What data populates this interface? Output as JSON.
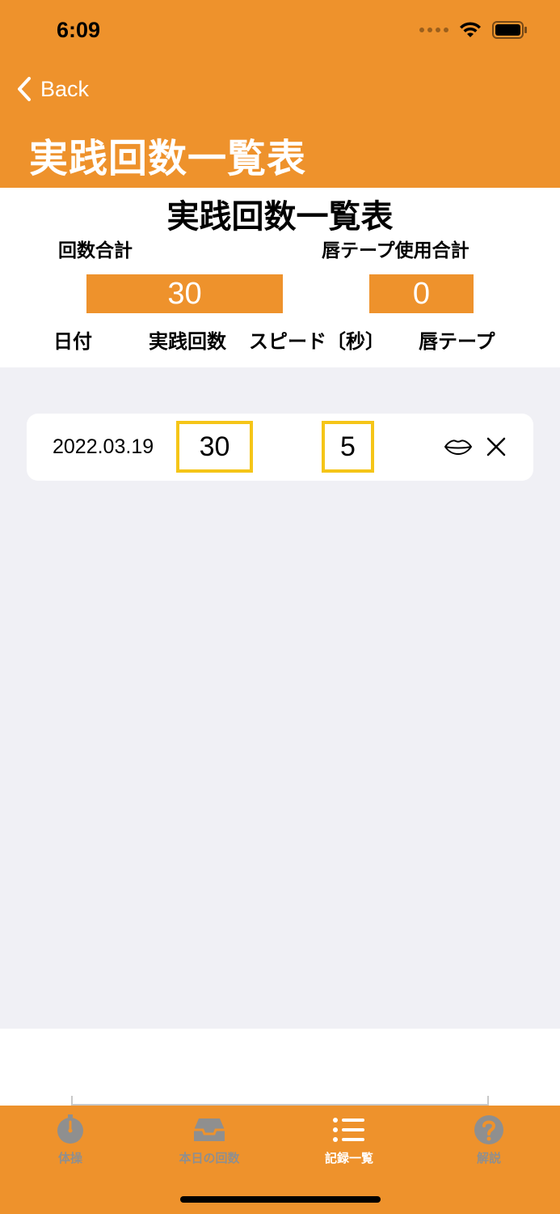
{
  "status_bar": {
    "time": "6:09"
  },
  "nav": {
    "back_label": "Back",
    "title": "実践回数一覧表"
  },
  "summary": {
    "title": "実践回数一覧表",
    "total_count_label": "回数合計",
    "total_tape_label": "唇テープ使用合計",
    "total_count_value": "30",
    "total_tape_value": "0"
  },
  "columns": [
    "日付",
    "実践回数",
    "スピード〔秒〕",
    "唇テープ"
  ],
  "records": [
    {
      "date": "2022.03.19",
      "count": "30",
      "speed": "5",
      "lips_icon": "lips-icon",
      "delete_icon": "close-icon"
    }
  ],
  "tabs": [
    {
      "label": "体操",
      "icon": "timer-icon",
      "active": false
    },
    {
      "label": "本日の回数",
      "icon": "tray-icon",
      "active": false
    },
    {
      "label": "記録一覧",
      "icon": "list-icon",
      "active": true
    },
    {
      "label": "解説",
      "icon": "question-icon",
      "active": false
    }
  ],
  "colors": {
    "accent": "#ee922c",
    "highlight_border": "#f5c518",
    "background": "#f0f0f5"
  }
}
